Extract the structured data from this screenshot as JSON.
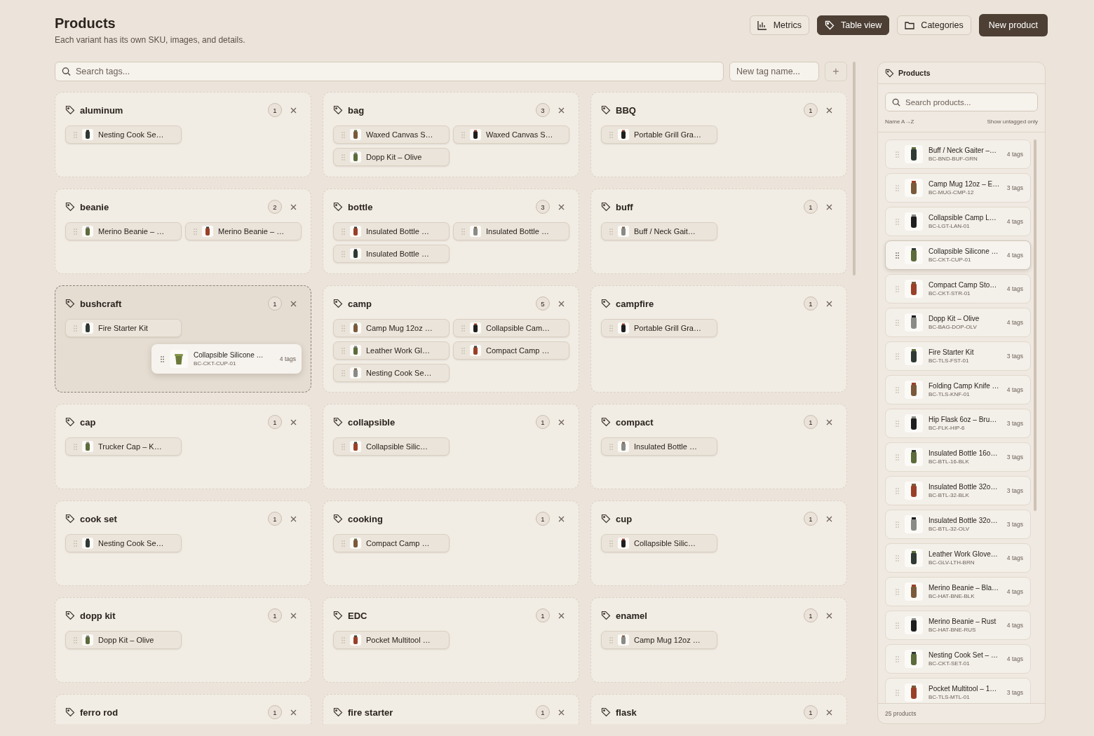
{
  "header": {
    "title": "Products",
    "subtitle": "Each variant has its own SKU, images, and details."
  },
  "toolbar": [
    {
      "label": "Metrics",
      "kind": "toggle",
      "selected": false
    },
    {
      "label": "Table view",
      "kind": "toggle",
      "selected": true
    },
    {
      "label": "Categories",
      "kind": "toggle",
      "selected": false
    },
    {
      "label": "New product",
      "kind": "primary"
    }
  ],
  "tag_search": {
    "placeholder": "Search tags..."
  },
  "new_tag": {
    "placeholder": "New tag name...",
    "add_label": "+"
  },
  "tags": [
    {
      "name": "aluminum",
      "count": "1",
      "drop_target": false,
      "products": [
        "Nesting Cook Se…"
      ]
    },
    {
      "name": "bag",
      "count": "3",
      "drop_target": false,
      "products": [
        "Waxed Canvas S…",
        "Waxed Canvas S…",
        "Dopp Kit – Olive"
      ]
    },
    {
      "name": "BBQ",
      "count": "1",
      "drop_target": false,
      "products": [
        "Portable Grill Gra…"
      ]
    },
    {
      "name": "beanie",
      "count": "2",
      "drop_target": false,
      "products": [
        "Merino Beanie – …",
        "Merino Beanie – …"
      ]
    },
    {
      "name": "bottle",
      "count": "3",
      "drop_target": false,
      "products": [
        "Insulated Bottle …",
        "Insulated Bottle …",
        "Insulated Bottle …"
      ]
    },
    {
      "name": "buff",
      "count": "1",
      "drop_target": false,
      "products": [
        "Buff / Neck Gait…"
      ]
    },
    {
      "name": "bushcraft",
      "count": "1",
      "drop_target": true,
      "products": [
        "Fire Starter Kit"
      ],
      "drag_preview": {
        "name": "Collapsible Silicone …",
        "sku": "BC-CKT-CUP-01",
        "tags": "4 tags"
      }
    },
    {
      "name": "camp",
      "count": "5",
      "drop_target": false,
      "products": [
        "Camp Mug 12oz …",
        "Collapsible Cam…",
        "Leather Work Gl…",
        "Compact Camp …",
        "Nesting Cook Se…"
      ]
    },
    {
      "name": "campfire",
      "count": "1",
      "drop_target": false,
      "products": [
        "Portable Grill Gra…"
      ]
    },
    {
      "name": "cap",
      "count": "1",
      "drop_target": false,
      "products": [
        "Trucker Cap – K…"
      ]
    },
    {
      "name": "collapsible",
      "count": "1",
      "drop_target": false,
      "products": [
        "Collapsible Silic…"
      ]
    },
    {
      "name": "compact",
      "count": "1",
      "drop_target": false,
      "products": [
        "Insulated Bottle …"
      ]
    },
    {
      "name": "cook set",
      "count": "1",
      "drop_target": false,
      "products": [
        "Nesting Cook Se…"
      ]
    },
    {
      "name": "cooking",
      "count": "1",
      "drop_target": false,
      "products": [
        "Compact Camp …"
      ]
    },
    {
      "name": "cup",
      "count": "1",
      "drop_target": false,
      "products": [
        "Collapsible Silic…"
      ]
    },
    {
      "name": "dopp kit",
      "count": "1",
      "drop_target": false,
      "products": [
        "Dopp Kit – Olive"
      ]
    },
    {
      "name": "EDC",
      "count": "1",
      "drop_target": false,
      "products": [
        "Pocket Multitool …"
      ]
    },
    {
      "name": "enamel",
      "count": "1",
      "drop_target": false,
      "products": [
        "Camp Mug 12oz …"
      ]
    },
    {
      "name": "ferro rod",
      "count": "1",
      "drop_target": false
    },
    {
      "name": "fire starter",
      "count": "1",
      "drop_target": false
    },
    {
      "name": "flask",
      "count": "1",
      "drop_target": false
    }
  ],
  "sidebar": {
    "title": "Products",
    "search_placeholder": "Search products...",
    "sort_label": "Name A→Z",
    "filter_label": "Show untagged only",
    "footer": "25 products",
    "items": [
      {
        "name": "Buff / Neck Gaiter –…",
        "sku": "BC-BND-BUF-GRN",
        "tags": "4 tags",
        "selected": false
      },
      {
        "name": "Camp Mug 12oz – E…",
        "sku": "BC-MUG-CMP-12",
        "tags": "3 tags",
        "selected": false
      },
      {
        "name": "Collapsible Camp L…",
        "sku": "BC-LGT-LAN-01",
        "tags": "4 tags",
        "selected": false
      },
      {
        "name": "Collapsible Silicone …",
        "sku": "BC-CKT-CUP-01",
        "tags": "4 tags",
        "selected": true
      },
      {
        "name": "Compact Camp Sto…",
        "sku": "BC-CKT-STR-01",
        "tags": "4 tags",
        "selected": false
      },
      {
        "name": "Dopp Kit – Olive",
        "sku": "BC-BAG-DOP-OLV",
        "tags": "4 tags",
        "selected": false
      },
      {
        "name": "Fire Starter Kit",
        "sku": "BC-TLS-FST-01",
        "tags": "3 tags",
        "selected": false
      },
      {
        "name": "Folding Camp Knife …",
        "sku": "BC-TLS-KNF-01",
        "tags": "4 tags",
        "selected": false
      },
      {
        "name": "Hip Flask 6oz – Bru…",
        "sku": "BC-FLK-HIP-6",
        "tags": "3 tags",
        "selected": false
      },
      {
        "name": "Insulated Bottle 16o…",
        "sku": "BC-BTL-16-BLK",
        "tags": "3 tags",
        "selected": false
      },
      {
        "name": "Insulated Bottle 32o…",
        "sku": "BC-BTL-32-BLK",
        "tags": "3 tags",
        "selected": false
      },
      {
        "name": "Insulated Bottle 32o…",
        "sku": "BC-BTL-32-OLV",
        "tags": "3 tags",
        "selected": false
      },
      {
        "name": "Leather Work Glove…",
        "sku": "BC-GLV-LTH-BRN",
        "tags": "4 tags",
        "selected": false
      },
      {
        "name": "Merino Beanie – Bla…",
        "sku": "BC-HAT-BNE-BLK",
        "tags": "4 tags",
        "selected": false
      },
      {
        "name": "Merino Beanie – Rust",
        "sku": "BC-HAT-BNE-RUS",
        "tags": "4 tags",
        "selected": false
      },
      {
        "name": "Nesting Cook Set – …",
        "sku": "BC-CKT-SET-01",
        "tags": "4 tags",
        "selected": false
      },
      {
        "name": "Pocket Multitool – 1…",
        "sku": "BC-TLS-MTL-01",
        "tags": "3 tags",
        "selected": false
      }
    ]
  }
}
